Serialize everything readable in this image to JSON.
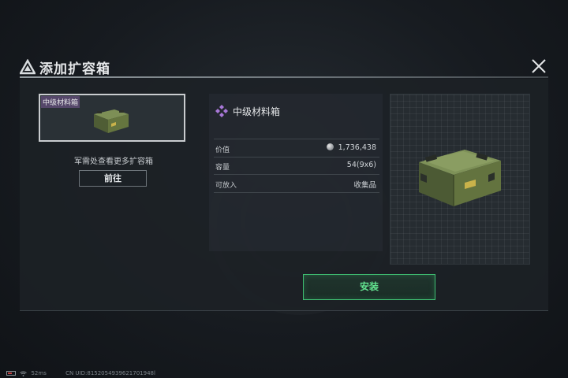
{
  "dialog": {
    "title": "添加扩容箱",
    "close_icon": "close-icon",
    "title_icon": "warning-triangle-icon"
  },
  "left_panel": {
    "selected_item_label": "中级材料箱",
    "more_text": "军需处查看更多扩容箱",
    "goto_button": "前往"
  },
  "item_info": {
    "name": "中级材料箱",
    "rarity_icon": "purple-diamond-icon",
    "rarity_color": "#a978d8",
    "rows": [
      {
        "key": "价值",
        "value": "1,736,438",
        "icon": "coin-icon"
      },
      {
        "key": "容量",
        "value": "54(9x6)"
      },
      {
        "key": "可放入",
        "value": "收集品"
      }
    ]
  },
  "actions": {
    "install_button": "安装",
    "accent_color": "#3fbf72"
  },
  "status_bar": {
    "ping": "52ms",
    "uid": "CN UID:8152054939621701948l"
  }
}
